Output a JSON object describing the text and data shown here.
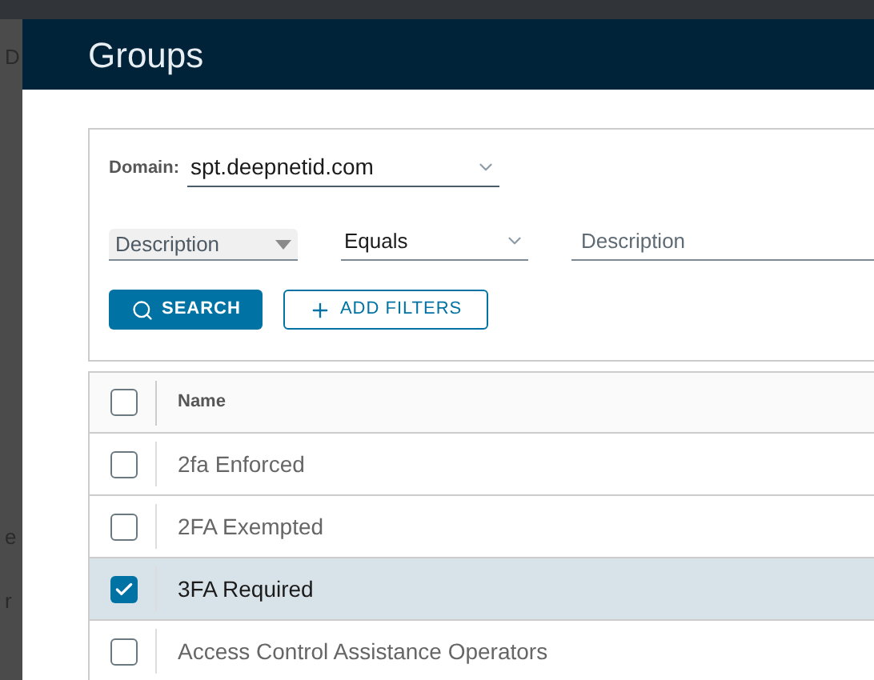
{
  "backdrop": {
    "texts": [
      "D",
      "e",
      "r"
    ]
  },
  "dialog": {
    "title": "Groups"
  },
  "filters": {
    "domain": {
      "label": "Domain:",
      "value": "spt.deepnetid.com"
    },
    "field": {
      "value": "Description"
    },
    "operator": {
      "value": "Equals"
    },
    "term": {
      "placeholder": "Description"
    },
    "buttons": [
      {
        "kind": "primary",
        "label": "SEARCH"
      },
      {
        "kind": "outline",
        "label": "ADD FILTERS"
      }
    ]
  },
  "table": {
    "header": {
      "checked": false,
      "label": "Name"
    },
    "rows": [
      {
        "name": "2fa Enforced",
        "selected": false
      },
      {
        "name": "2FA Exempted",
        "selected": false
      },
      {
        "name": "3FA Required",
        "selected": true
      },
      {
        "name": "Access Control Assistance Operators",
        "selected": false
      }
    ]
  }
}
